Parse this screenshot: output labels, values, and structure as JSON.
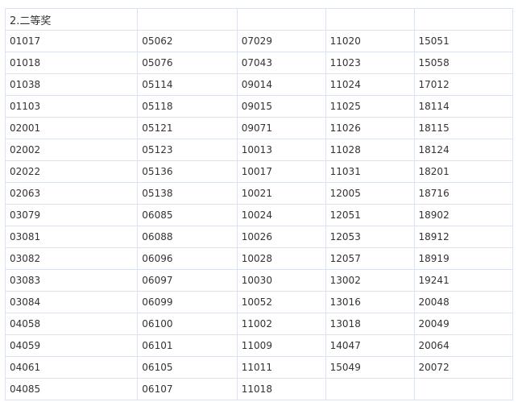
{
  "section_title": "2.二等奖",
  "rows": [
    [
      "01017",
      "05062",
      "07029",
      "11020",
      "15051"
    ],
    [
      "01018",
      "05076",
      "07043",
      "11023",
      "15058"
    ],
    [
      "01038",
      "05114",
      "09014",
      "11024",
      "17012"
    ],
    [
      "01103",
      "05118",
      "09015",
      "11025",
      "18114"
    ],
    [
      "02001",
      "05121",
      "09071",
      "11026",
      "18115"
    ],
    [
      "02002",
      "05123",
      "10013",
      "11028",
      "18124"
    ],
    [
      "02022",
      "05136",
      "10017",
      "11031",
      "18201"
    ],
    [
      "02063",
      "05138",
      "10021",
      "12005",
      "18716"
    ],
    [
      "03079",
      "06085",
      "10024",
      "12051",
      "18902"
    ],
    [
      "03081",
      "06088",
      "10026",
      "12053",
      "18912"
    ],
    [
      "03082",
      "06096",
      "10028",
      "12057",
      "18919"
    ],
    [
      "03083",
      "06097",
      "10030",
      "13002",
      "19241"
    ],
    [
      "03084",
      "06099",
      "10052",
      "13016",
      "20048"
    ],
    [
      "04058",
      "06100",
      "11002",
      "13018",
      "20049"
    ],
    [
      "04059",
      "06101",
      "11009",
      "14047",
      "20064"
    ],
    [
      "04061",
      "06105",
      "11011",
      "15049",
      "20072"
    ],
    [
      "04085",
      "06107",
      "11018",
      "",
      ""
    ]
  ]
}
